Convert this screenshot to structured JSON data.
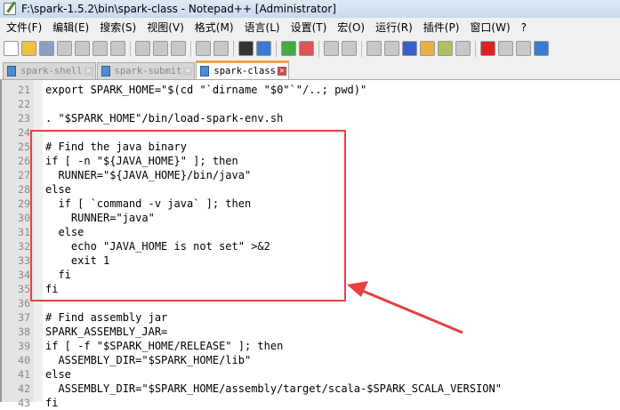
{
  "window": {
    "title": "F:\\spark-1.5.2\\bin\\spark-class - Notepad++ [Administrator]"
  },
  "menu": [
    "文件(F)",
    "编辑(E)",
    "搜索(S)",
    "视图(V)",
    "格式(M)",
    "语言(L)",
    "设置(T)",
    "宏(O)",
    "运行(R)",
    "插件(P)",
    "窗口(W)",
    "?"
  ],
  "toolbar": [
    "new-icon",
    "open-icon",
    "save-icon",
    "save-all-icon",
    "close-icon",
    "close-all-icon",
    "print-icon",
    "|",
    "cut-icon",
    "copy-icon",
    "paste-icon",
    "|",
    "undo-icon",
    "redo-icon",
    "|",
    "find-icon",
    "replace-icon",
    "|",
    "zoom-in-icon",
    "zoom-out-icon",
    "|",
    "sync-v-icon",
    "sync-h-icon",
    "|",
    "wrap-icon",
    "show-all-chars-icon",
    "indent-guide-icon",
    "lang-icon",
    "map-icon",
    "doc-icon",
    "|",
    "record-icon",
    "stop-icon",
    "play-icon",
    "fast-forward-icon"
  ],
  "tabs": [
    {
      "label": "spark-shell",
      "active": false
    },
    {
      "label": "spark-submit",
      "active": false
    },
    {
      "label": "spark-class",
      "active": true
    }
  ],
  "lines": [
    {
      "n": "21",
      "t": "export SPARK_HOME=\"$(cd \"`dirname \"$0\"`\"/..; pwd)\""
    },
    {
      "n": "22",
      "t": ""
    },
    {
      "n": "23",
      "t": ". \"$SPARK_HOME\"/bin/load-spark-env.sh"
    },
    {
      "n": "24",
      "t": ""
    },
    {
      "n": "25",
      "t": "# Find the java binary"
    },
    {
      "n": "26",
      "t": "if [ -n \"${JAVA_HOME}\" ]; then"
    },
    {
      "n": "27",
      "t": "  RUNNER=\"${JAVA_HOME}/bin/java\""
    },
    {
      "n": "28",
      "t": "else"
    },
    {
      "n": "29",
      "t": "  if [ `command -v java` ]; then"
    },
    {
      "n": "30",
      "t": "    RUNNER=\"java\""
    },
    {
      "n": "31",
      "t": "  else"
    },
    {
      "n": "32",
      "t": "    echo \"JAVA_HOME is not set\" >&2"
    },
    {
      "n": "33",
      "t": "    exit 1"
    },
    {
      "n": "34",
      "t": "  fi"
    },
    {
      "n": "35",
      "t": "fi"
    },
    {
      "n": "36",
      "t": ""
    },
    {
      "n": "37",
      "t": "# Find assembly jar"
    },
    {
      "n": "38",
      "t": "SPARK_ASSEMBLY_JAR="
    },
    {
      "n": "39",
      "t": "if [ -f \"$SPARK_HOME/RELEASE\" ]; then"
    },
    {
      "n": "40",
      "t": "  ASSEMBLY_DIR=\"$SPARK_HOME/lib\""
    },
    {
      "n": "41",
      "t": "else"
    },
    {
      "n": "42",
      "t": "  ASSEMBLY_DIR=\"$SPARK_HOME/assembly/target/scala-$SPARK_SCALA_VERSION\""
    },
    {
      "n": "43",
      "t": "fi"
    }
  ],
  "colors": {
    "annotation": "#e8403f",
    "active_tab_accent": "#f5a04a"
  }
}
